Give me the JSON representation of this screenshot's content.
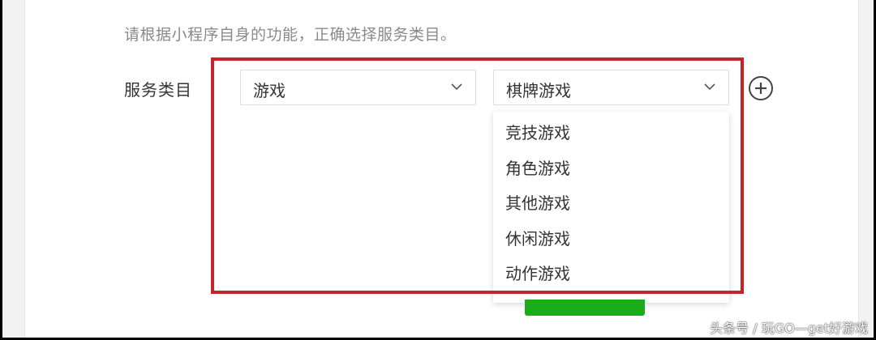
{
  "form": {
    "hint": "请根据小程序自身的功能，正确选择服务类目。",
    "label": "服务类目",
    "primary_select": {
      "value": "游戏"
    },
    "secondary_select": {
      "value": "棋牌游戏",
      "options": [
        "竞技游戏",
        "角色游戏",
        "其他游戏",
        "休闲游戏",
        "动作游戏"
      ]
    }
  },
  "colors": {
    "highlight": "#c8222a",
    "confirm_button": "#1aad19"
  },
  "icons": {
    "add": "add-circle-icon",
    "chevron": "chevron-down-icon"
  },
  "watermark": "头条号 / 玩GO—get好游戏"
}
